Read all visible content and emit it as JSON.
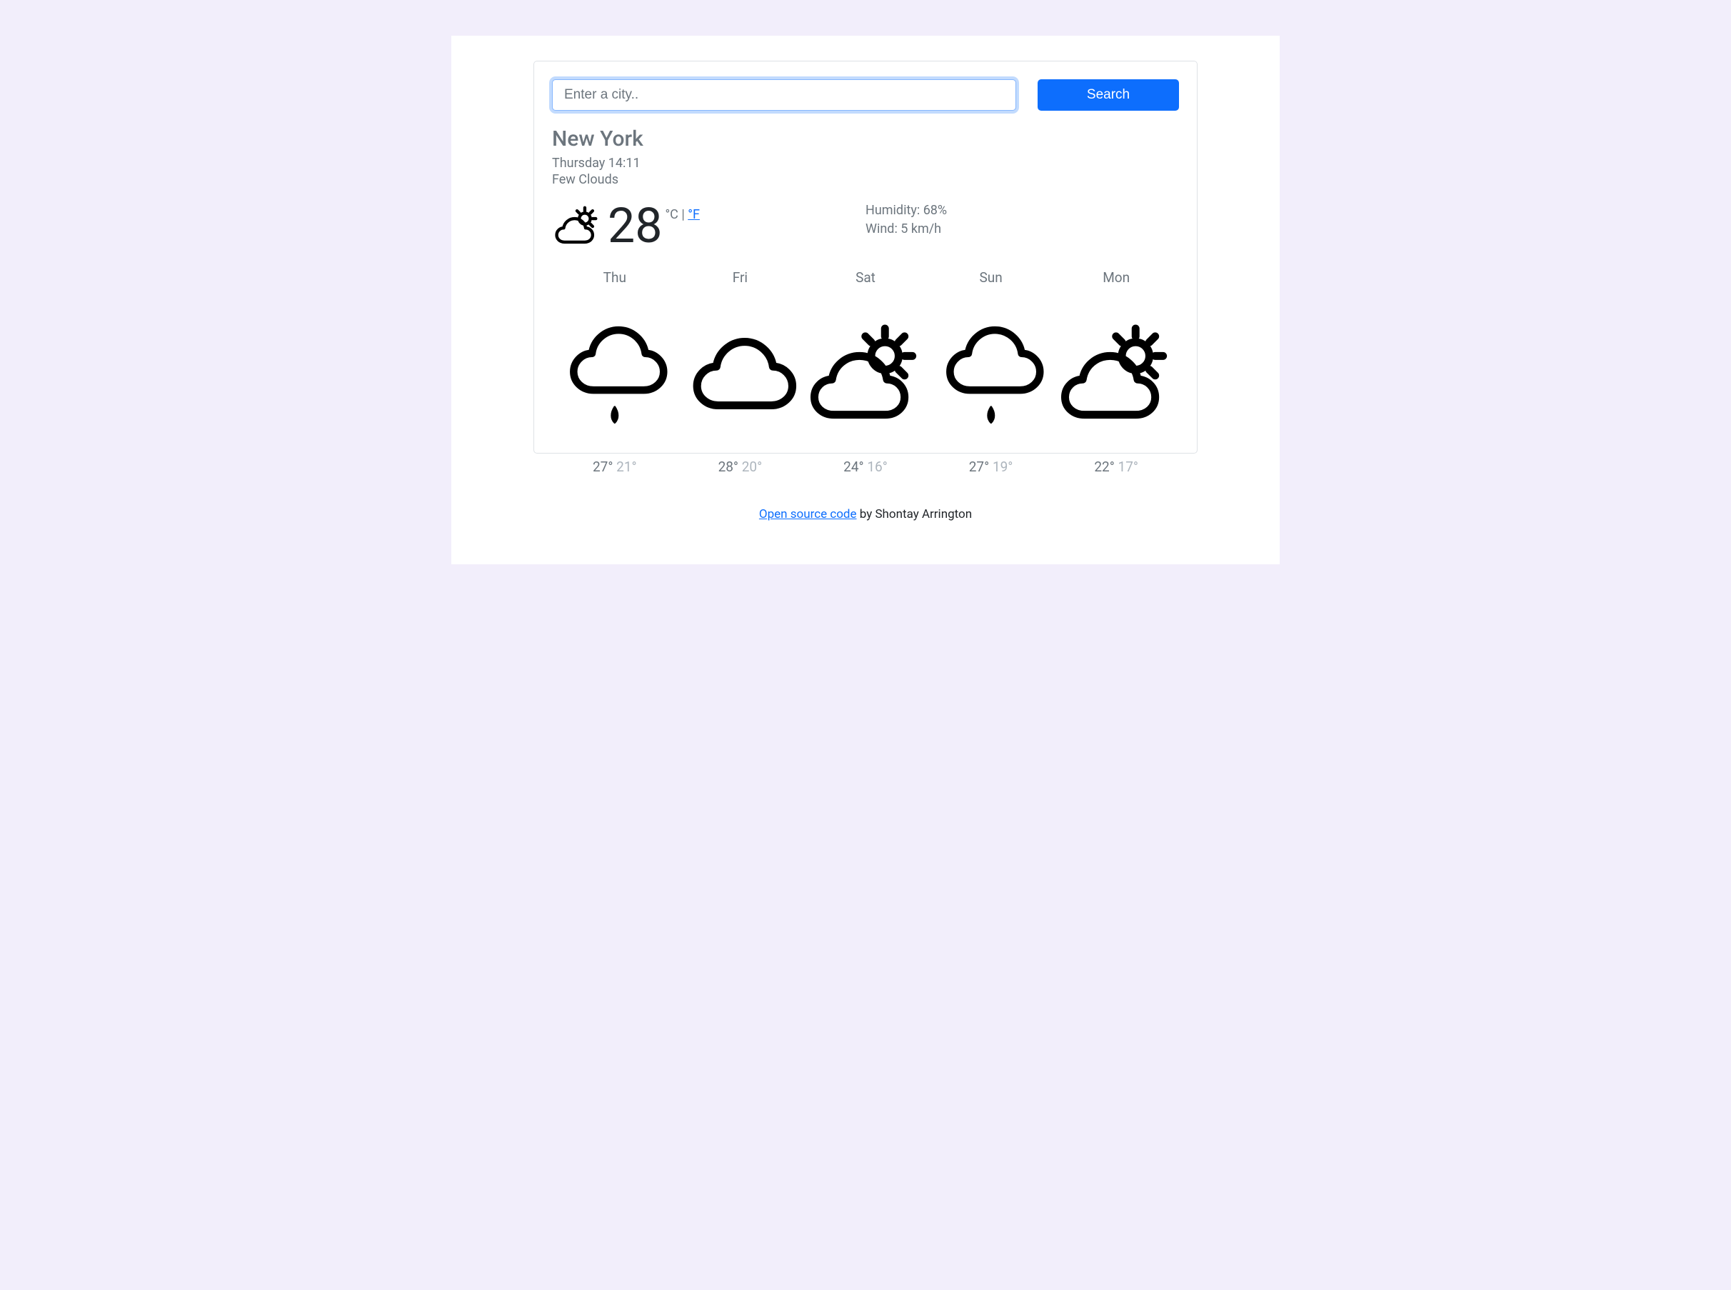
{
  "search": {
    "placeholder": "Enter a city..",
    "button_label": "Search"
  },
  "overview": {
    "city": "New York",
    "datetime": "Thursday 14:11",
    "description": "Few Clouds"
  },
  "current": {
    "temp": "28",
    "unit_active": "°C",
    "unit_separator": " | ",
    "unit_link": "°F",
    "humidity_label": "Humidity: ",
    "humidity_value": "68%",
    "wind_label": "Wind: ",
    "wind_value": "5 km/h",
    "icon": "cloud-sun"
  },
  "forecast": [
    {
      "day": "Thu",
      "high": "27°",
      "low": "21°",
      "icon": "cloud-rain"
    },
    {
      "day": "Fri",
      "high": "28°",
      "low": "20°",
      "icon": "cloud"
    },
    {
      "day": "Sat",
      "high": "24°",
      "low": "16°",
      "icon": "cloud-sun"
    },
    {
      "day": "Sun",
      "high": "27°",
      "low": "19°",
      "icon": "cloud-rain"
    },
    {
      "day": "Mon",
      "high": "22°",
      "low": "17°",
      "icon": "cloud-sun"
    }
  ],
  "footer": {
    "link_text": "Open source code",
    "by_text": " by Shontay Arrington"
  }
}
